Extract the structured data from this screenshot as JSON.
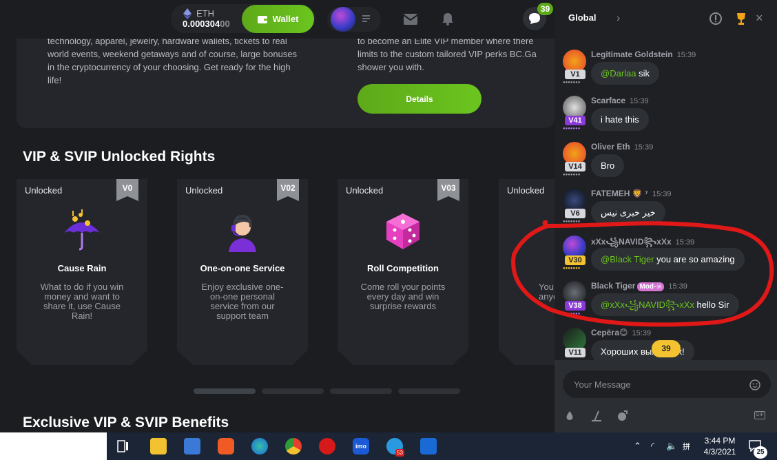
{
  "header": {
    "currency": "ETH",
    "balance_main": "0.000304",
    "balance_dim": "00",
    "wallet_label": "Wallet",
    "chat_badge": "39"
  },
  "promo": {
    "left_lines": "technology, apparel, jewelry, hardware wallets, tickets to real world events, weekend getaways and of course, large bonuses in the cryptocurrency of your choosing. Get ready for the high life!",
    "right_lines": "to become an Elite VIP member where there limits to the custom tailored VIP perks BC.Ga shower you with.",
    "details_label": "Details"
  },
  "sections": {
    "unlocked_rights": "VIP & SVIP Unlocked Rights",
    "benefits": "Exclusive VIP & SVIP Benefits"
  },
  "cards": [
    {
      "status": "Unlocked",
      "tag": "V0",
      "title": "Cause Rain",
      "desc": "What to do if you win money and want to share it, use Cause Rain!",
      "icon": "umbrella-rain-icon"
    },
    {
      "status": "Unlocked",
      "tag": "V02",
      "title": "One-on-one Service",
      "desc": "Enjoy exclusive one-on-one personal service from our support team",
      "icon": "support-agent-icon"
    },
    {
      "status": "Unlocked",
      "tag": "V03",
      "title": "Roll Competition",
      "desc": "Come roll your points every day and win surprise rewards",
      "icon": "dice-icon"
    },
    {
      "status": "Unlocked",
      "tag": "",
      "title": "",
      "desc": "You anyor",
      "icon": "partial-icon"
    }
  ],
  "chat": {
    "tab": "Global",
    "placeholder": "Your Message",
    "new_count": "39",
    "messages": [
      {
        "name": "Legitimate Goldstein",
        "time": "15:39",
        "level": "V1",
        "mention": "@Darlaa",
        "text": " sik",
        "level_color": "#d6d8dc"
      },
      {
        "name": "Scarface",
        "time": "15:39",
        "level": "V41",
        "mention": "",
        "text": "i hate this",
        "level_color": "#8a3ad6"
      },
      {
        "name": "Oliver Eth",
        "time": "15:39",
        "level": "V14",
        "mention": "",
        "text": "Bro",
        "level_color": "#d6d8dc"
      },
      {
        "name": "FATEMEH 🦁 ⁷",
        "time": "15:39",
        "level": "V6",
        "mention": "",
        "text": "خیر خبری نیس",
        "level_color": "#d6d8dc"
      },
      {
        "name": "xXx꧁NAVID꧂xXx",
        "time": "15:39",
        "level": "V30",
        "mention": "@Black Tiger",
        "text": " you are so amazing",
        "level_color": "#f2c230"
      },
      {
        "name": "Black Tiger",
        "mod": "Mod-☠",
        "time": "15:39",
        "level": "V38",
        "mention": "@xXx꧁NAVID꧂xXx",
        "text": " hello Sir",
        "level_color": "#8a3ad6"
      },
      {
        "name": "Серёга😊",
        "time": "15:39",
        "level": "V11",
        "mention": "",
        "text": "Хороших выходных!",
        "level_color": "#d6d8dc"
      }
    ]
  },
  "taskbar": {
    "time": "3:44 PM",
    "date": "4/3/2021",
    "notifications": "25",
    "telegram_badge": "53"
  }
}
